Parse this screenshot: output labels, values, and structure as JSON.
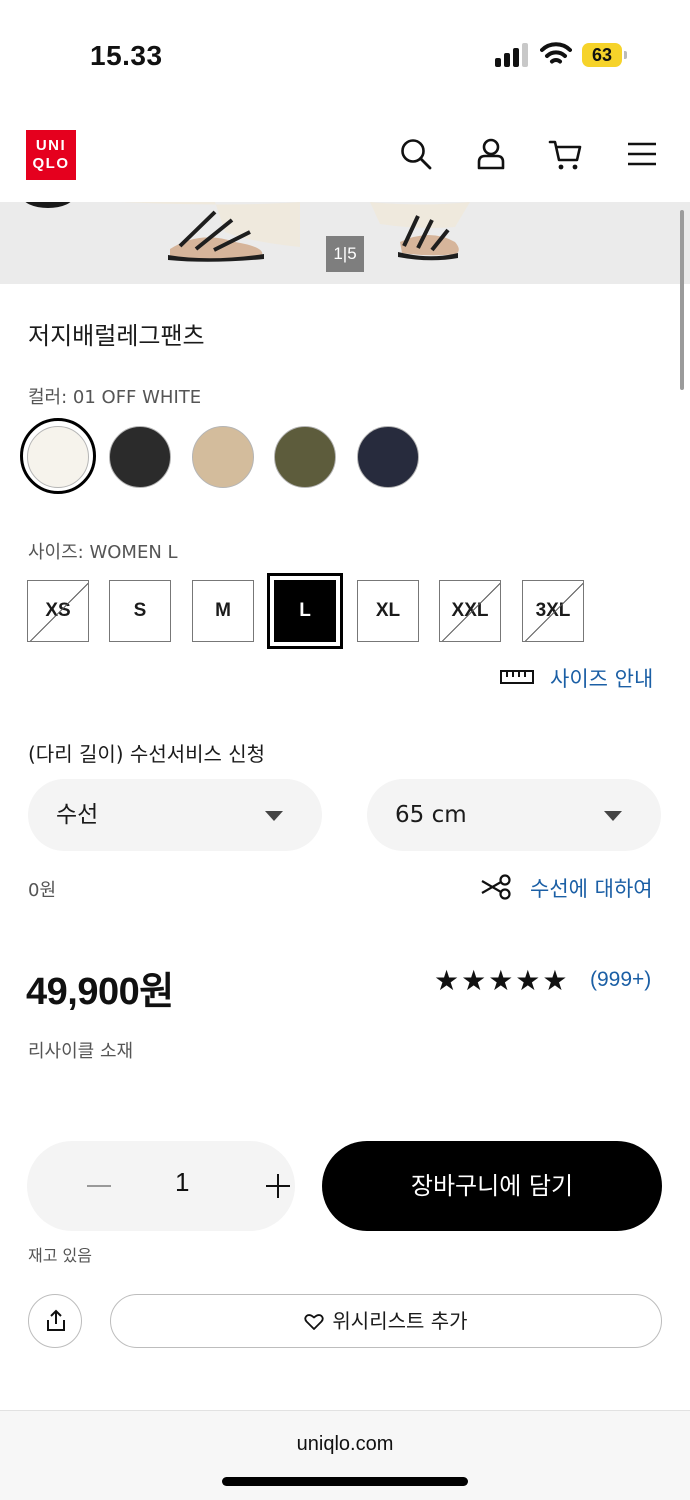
{
  "status_bar": {
    "time": "15.33",
    "battery": "63"
  },
  "header": {
    "logo_line1": "UNI",
    "logo_line2": "QLO",
    "icons": [
      "search-icon",
      "account-icon",
      "cart-icon",
      "menu-icon"
    ]
  },
  "gallery": {
    "pager": "1|5"
  },
  "product": {
    "title": "저지배럴레그팬츠",
    "color_label": "컬러: 01 OFF WHITE",
    "colors": [
      {
        "name": "off-white",
        "hex": "#f6f3ec"
      },
      {
        "name": "black",
        "hex": "#2b2b2b"
      },
      {
        "name": "beige",
        "hex": "#d3bc9c"
      },
      {
        "name": "olive",
        "hex": "#5d5c3c"
      },
      {
        "name": "navy",
        "hex": "#272b3d"
      }
    ],
    "size_label": "사이즈: WOMEN L",
    "sizes": [
      {
        "label": "XS",
        "state": "disabled"
      },
      {
        "label": "S",
        "state": "available"
      },
      {
        "label": "M",
        "state": "available"
      },
      {
        "label": "L",
        "state": "selected"
      },
      {
        "label": "XL",
        "state": "available"
      },
      {
        "label": "XXL",
        "state": "disabled"
      },
      {
        "label": "3XL",
        "state": "disabled"
      }
    ],
    "size_guide": "사이즈 안내",
    "alteration": {
      "label": "(다리 길이) 수선서비스 신청",
      "type_value": "수선",
      "length_value": "65 cm",
      "fee": "0원",
      "info_link": "수선에 대하여"
    },
    "price": "49,900원",
    "stars": "★★★★★",
    "reviews": "(999+)",
    "material_note": "리사이클 소재",
    "quantity": "1",
    "add_to_cart": "장바구니에 담기",
    "stock_status": "재고 있음",
    "wishlist": "위시리스트 추가"
  },
  "browser": {
    "url": "uniqlo.com"
  },
  "colors": {
    "brand_red": "#e5001e",
    "link_blue": "#1b5fa5",
    "rating_star": "#111111"
  }
}
